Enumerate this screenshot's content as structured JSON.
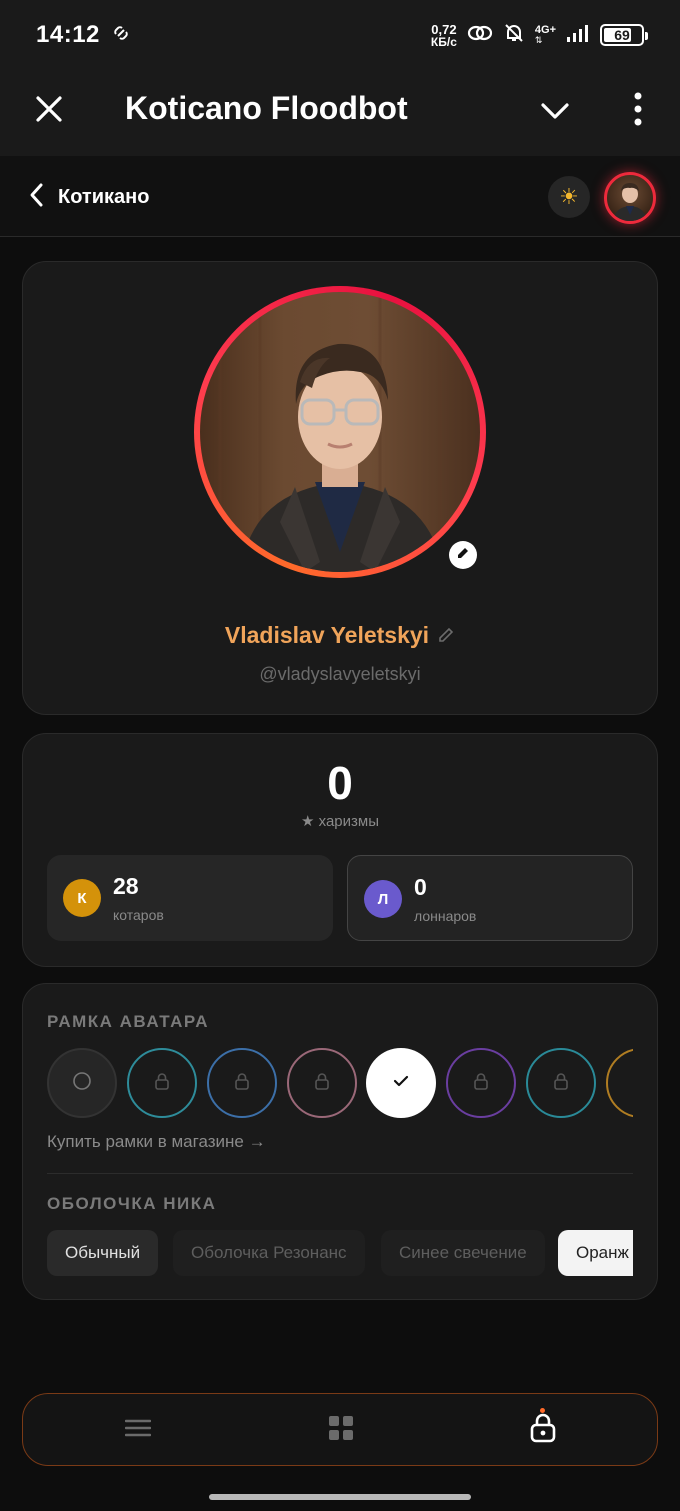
{
  "status_bar": {
    "time": "14:12",
    "net_speed_value": "0,72",
    "net_speed_unit": "КБ/с",
    "mobile_label": "4G+",
    "battery": "69"
  },
  "header": {
    "title": "Koticano Floodbot"
  },
  "nav": {
    "back_label": "Котикано",
    "theme_icon": "sun-icon"
  },
  "profile": {
    "name": "Vladislav Yeletskyi",
    "handle": "@vladyslavyeletskyi"
  },
  "stats": {
    "charisma_value": "0",
    "charisma_label": "★ харизмы",
    "boxes": [
      {
        "initial": "К",
        "value": "28",
        "label": "котаров",
        "color": "#d4920a"
      },
      {
        "initial": "Л",
        "value": "0",
        "label": "лоннаров",
        "color": "#6a5acd"
      }
    ]
  },
  "frames": {
    "section_title": "РАМКА АВАТАРА",
    "shop_link": "Купить рамки в магазине →",
    "items": [
      {
        "name": "none",
        "color": "#2a2a2a",
        "state": "empty"
      },
      {
        "name": "teal",
        "color": "#2e8c9a",
        "state": "locked"
      },
      {
        "name": "blue",
        "color": "#3c6fa8",
        "state": "locked"
      },
      {
        "name": "rose",
        "color": "#9a6878",
        "state": "locked"
      },
      {
        "name": "white",
        "color": "#ffffff",
        "state": "selected"
      },
      {
        "name": "purple",
        "color": "#6a3ea0",
        "state": "locked"
      },
      {
        "name": "cyan",
        "color": "#2a8a98",
        "state": "locked"
      },
      {
        "name": "gold",
        "color": "#b07d22",
        "state": "locked"
      }
    ]
  },
  "nick_shell": {
    "section_title": "ОБОЛОЧКА НИКА",
    "options": [
      {
        "label": "Обычный",
        "state": "available"
      },
      {
        "label": "Оболочка Резонанс",
        "state": "locked"
      },
      {
        "label": "Синее свечение",
        "state": "locked"
      },
      {
        "label": "Оранж",
        "state": "selected"
      }
    ]
  },
  "bottom_nav": {
    "items": [
      "menu-icon",
      "grid-icon",
      "lock-icon"
    ],
    "active": "lock-icon"
  }
}
